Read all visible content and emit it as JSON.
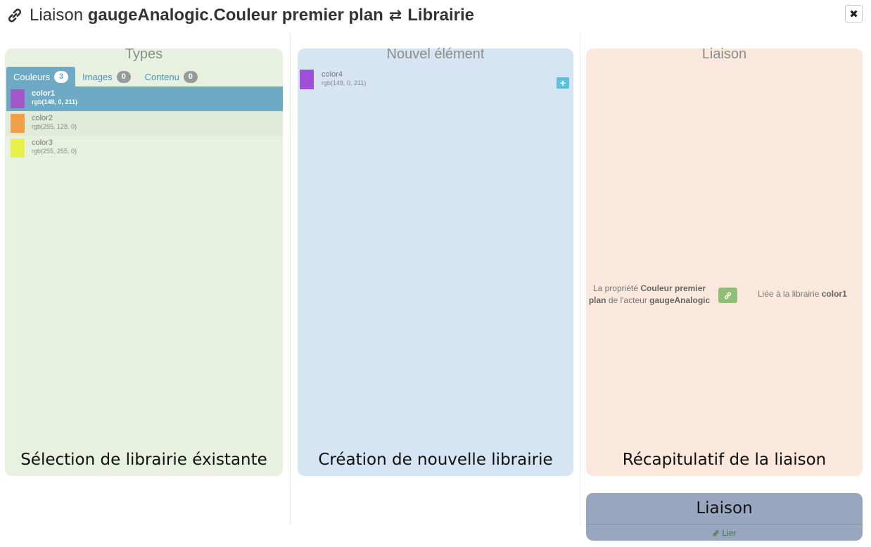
{
  "header": {
    "prefix": "Liaison",
    "actor": "gaugeAnalogic",
    "sep": ".",
    "property": "Couleur premier plan",
    "swap_glyph": "⇄",
    "target": "Librairie",
    "close_label": "✖"
  },
  "types_panel": {
    "heading": "Types",
    "tabs": [
      {
        "label": "Couleurs",
        "count": "3"
      },
      {
        "label": "Images",
        "count": "0"
      },
      {
        "label": "Contenu",
        "count": "0"
      }
    ],
    "colors": [
      {
        "name": "color1",
        "value": "rgb(148, 0, 211)",
        "swatch": "#a455c9"
      },
      {
        "name": "color2",
        "value": "rgb(255, 128, 0)",
        "swatch": "#f0a04a"
      },
      {
        "name": "color3",
        "value": "rgb(255, 255, 0)",
        "swatch": "#e8f04a"
      }
    ],
    "caption": "Sélection de librairie éxistante"
  },
  "new_panel": {
    "heading": "Nouvel élément",
    "item": {
      "name": "color4",
      "value": "rgb(148, 0, 211)",
      "swatch": "#a050d8"
    },
    "add_label": "+",
    "caption": "Création de nouvelle librairie"
  },
  "summary_panel": {
    "heading": "Liaison",
    "left_pre": "La propriété",
    "left_prop": "Couleur premier plan",
    "left_mid": "de l'acteur",
    "left_actor": "gaugeAnalogic",
    "right_pre": "Liée à la librairie",
    "right_lib": "color1",
    "caption": "Récapitulatif de la liaison"
  },
  "bottom": {
    "caption": "Liaison",
    "lier_label": "Lier"
  },
  "colors": {
    "green_panel": "#e8f1e0",
    "blue_panel": "#d6e5f3",
    "orange_panel": "#fbe8dc",
    "selected": "#6ea9c6",
    "link_badge": "#8fbf74",
    "add_button": "#5bc0de"
  }
}
